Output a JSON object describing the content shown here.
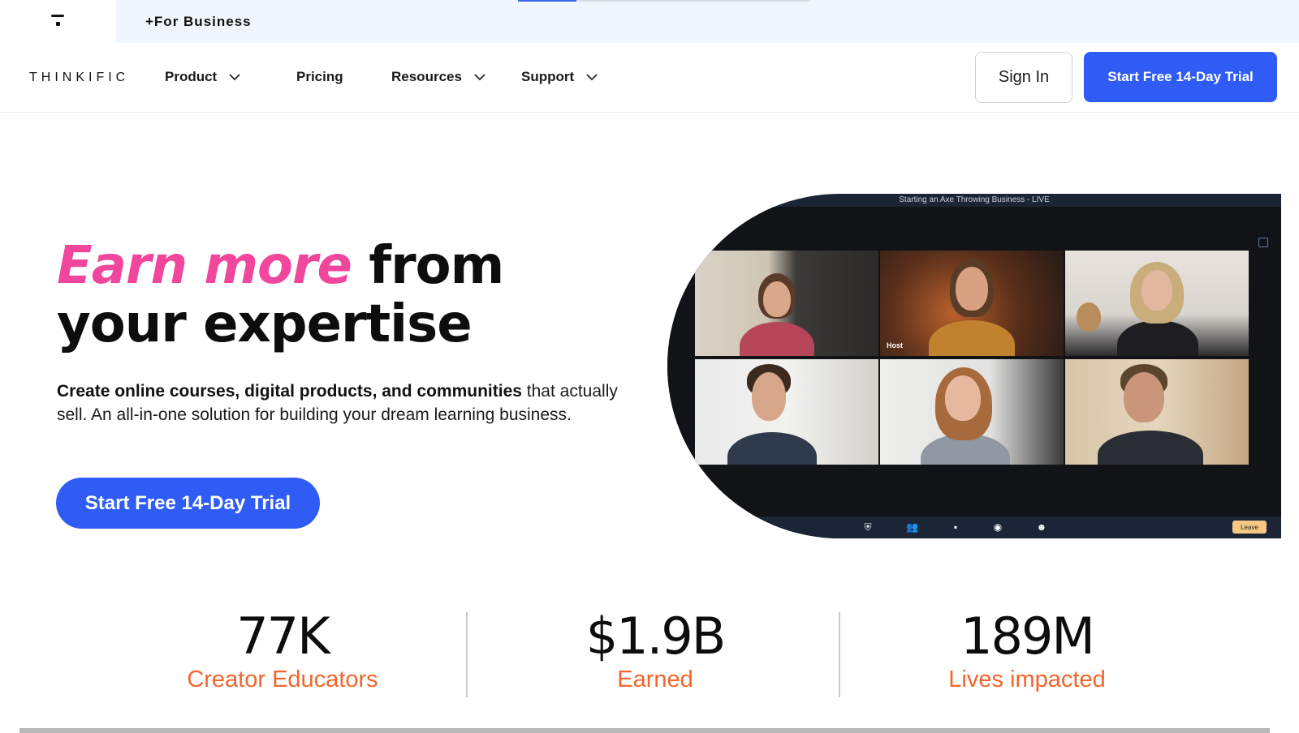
{
  "topbar": {
    "for_business": "+For Business"
  },
  "nav": {
    "brand": "THINKIFIC",
    "items": [
      {
        "label": "Product",
        "has_dropdown": true
      },
      {
        "label": "Pricing",
        "has_dropdown": false
      },
      {
        "label": "Resources",
        "has_dropdown": true
      },
      {
        "label": "Support",
        "has_dropdown": true
      }
    ],
    "sign_in": "Sign In",
    "cta": "Start Free 14-Day Trial"
  },
  "hero": {
    "headline_accent": "Earn more",
    "headline_rest": "from your expertise",
    "sub_bold": "Create online courses, digital products, and communities",
    "sub_rest": "that actually sell. An all-in-one solution for building your dream learning business.",
    "cta": "Start Free 14-Day Trial"
  },
  "mockup": {
    "title": "Starting an Axe Throwing Business - LIVE",
    "host_label": "Host",
    "leave_label": "Leave",
    "toolbar_icons": [
      "shield-icon",
      "participants-icon",
      "chat-icon",
      "record-icon",
      "reactions-icon"
    ]
  },
  "stats": [
    {
      "value": "77K",
      "label": "Creator Educators"
    },
    {
      "value": "$1.9B",
      "label": "Earned"
    },
    {
      "value": "189M",
      "label": "Lives impacted"
    }
  ],
  "colors": {
    "accent_pink": "#f0469c",
    "primary_blue": "#2f5cf5",
    "stat_orange": "#f2652b",
    "topbar_bg": "#f0f6fd"
  }
}
